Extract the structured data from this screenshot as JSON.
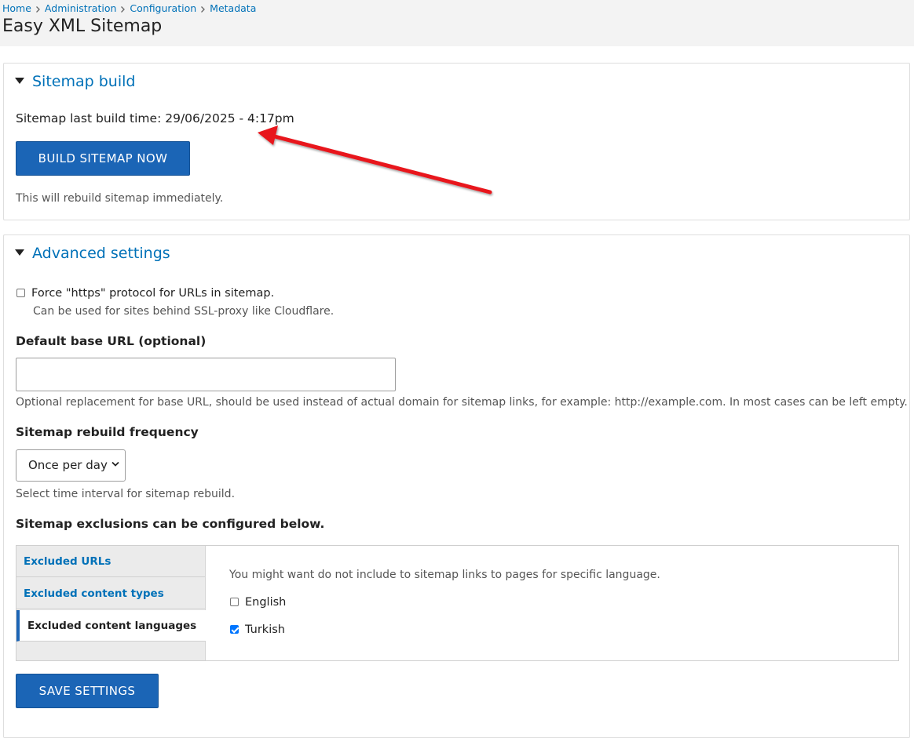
{
  "breadcrumb": [
    "Home",
    "Administration",
    "Configuration",
    "Metadata"
  ],
  "page_title": "Easy XML Sitemap",
  "sitemap_build": {
    "summary": "Sitemap build",
    "last_build_text": "Sitemap last build time: 29/06/2025 - 4:17pm",
    "button_label": "BUILD SITEMAP NOW",
    "description": "This will rebuild sitemap immediately."
  },
  "advanced": {
    "summary": "Advanced settings",
    "force_https_label": "Force \"https\" protocol for URLs in sitemap.",
    "force_https_checked": false,
    "force_https_desc": "Can be used for sites behind SSL-proxy like Cloudflare.",
    "base_url_label": "Default base URL (optional)",
    "base_url_value": "",
    "base_url_desc": "Optional replacement for base URL, should be used instead of actual domain for sitemap links, for example: http://example.com. In most cases can be left empty.",
    "frequency_label": "Sitemap rebuild frequency",
    "frequency_value": "Once per day",
    "frequency_desc": "Select time interval for sitemap rebuild.",
    "exclusions_heading": "Sitemap exclusions can be configured below.",
    "tabs": [
      "Excluded URLs",
      "Excluded content types",
      "Excluded content languages"
    ],
    "active_tab": "Excluded content languages",
    "languages_desc": "You might want do not include to sitemap links to pages for specific language.",
    "languages": [
      {
        "label": "English",
        "checked": false
      },
      {
        "label": "Turkish",
        "checked": true
      }
    ],
    "save_label": "SAVE SETTINGS"
  },
  "colors": {
    "link": "#0071b8",
    "button": "#1b65b6",
    "annotation_arrow": "#e8141b"
  }
}
